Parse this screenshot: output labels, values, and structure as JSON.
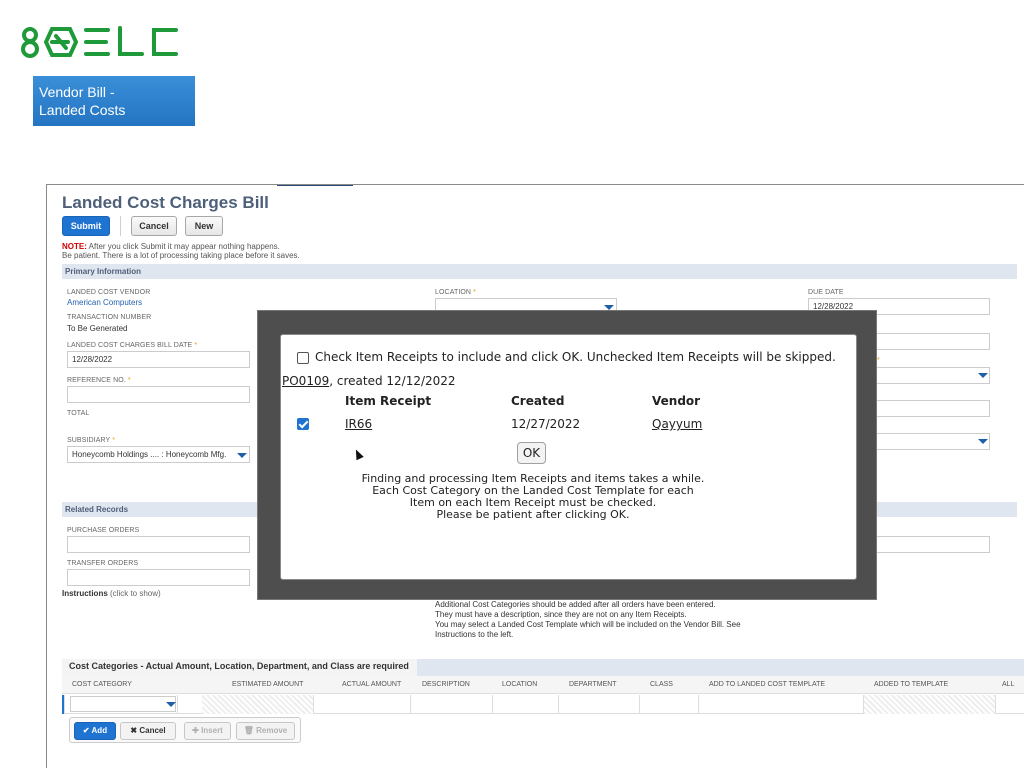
{
  "logo": {
    "text": "8QELC"
  },
  "topic_badge": {
    "line1": "Vendor Bill -",
    "line2": "Landed Costs"
  },
  "form": {
    "title": "Landed Cost Charges Bill",
    "buttons": {
      "submit": "Submit",
      "cancel": "Cancel",
      "new": "New"
    },
    "note_label": "NOTE:",
    "note_line1": "After you click Submit it may appear nothing happens.",
    "note_line2": "Be patient. There is a lot of processing taking place before it saves.",
    "primary_section": "Primary Information",
    "fields": {
      "vendor_label": "LANDED COST VENDOR",
      "vendor_value": "American Computers",
      "txn_label": "TRANSACTION NUMBER",
      "txn_value": "To Be Generated",
      "date_label": "LANDED COST CHARGES BILL DATE",
      "date_value": "12/28/2022",
      "ref_label": "REFERENCE NO.",
      "total_label": "TOTAL",
      "subsidiary_label": "SUBSIDIARY",
      "subsidiary_value": "Honeycomb Holdings .... : Honeycomb Mfg.",
      "location_label": "LOCATION",
      "due_label": "DUE DATE",
      "due_value": "12/28/2022",
      "required_mark": "*"
    },
    "related_section": "Related Records",
    "purchase_orders_label": "PURCHASE ORDERS",
    "transfer_orders_label": "TRANSFER ORDERS",
    "instructions_label": "Instructions",
    "instructions_hint": "(click to show)",
    "instructions_text": [
      "Additional Cost Categories should be added after all orders have been entered.",
      "They must have a description, since they are not on any Item Receipts.",
      "You may select a Landed Cost Template which will be included on the Vendor Bill. See",
      "Instructions to the left."
    ],
    "sublist": {
      "title": "Cost Categories - Actual Amount, Location, Department, and Class are required",
      "columns": [
        "COST CATEGORY",
        "ESTIMATED AMOUNT",
        "ACTUAL AMOUNT",
        "DESCRIPTION",
        "LOCATION",
        "DEPARTMENT",
        "CLASS",
        "ADD TO LANDED COST TEMPLATE",
        "ADDED TO TEMPLATE",
        "ALL"
      ],
      "buttons": {
        "add": "Add",
        "cancel": "Cancel",
        "insert": "Insert",
        "remove": "Remove"
      }
    }
  },
  "modal": {
    "header_text": "Check Item Receipts to include and click OK. Unchecked Item Receipts will be skipped.",
    "header_checked": false,
    "po_link": "PO0109",
    "po_suffix": ", created 12/12/2022",
    "columns": {
      "receipt": "Item Receipt",
      "created": "Created",
      "vendor": "Vendor"
    },
    "rows": [
      {
        "checked": true,
        "receipt": "IR66",
        "created": "12/27/2022",
        "vendor": "Qayyum"
      }
    ],
    "ok_label": "OK",
    "message": [
      "Finding and processing Item Receipts and items takes a while.",
      "Each Cost Category on the Landed Cost Template for each",
      "Item on each Item Receipt must be checked.",
      "Please be patient after clicking OK."
    ]
  },
  "colors": {
    "logo": "#1f9a3a",
    "primary_button": "#1f73d1",
    "section_bar": "#e0e6ef",
    "title_text": "#4d5f79",
    "modal_overlay": "#4e4e4e"
  }
}
